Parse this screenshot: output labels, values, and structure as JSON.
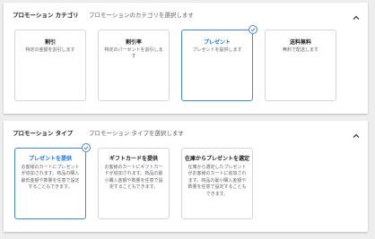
{
  "category_panel": {
    "title": "プロモーション カテゴリ",
    "subtitle": "プロモーションのカテゴリを選択します",
    "cards": [
      {
        "title": "割引",
        "desc": "特定の金額を割引します"
      },
      {
        "title": "割引率",
        "desc": "特定のパーセントを割引します"
      },
      {
        "title": "プレゼント",
        "desc": "プレゼントを提供します"
      },
      {
        "title": "送料無料",
        "desc": "無料で配送します"
      }
    ],
    "selected_index": 2
  },
  "type_panel": {
    "title": "プロモーション タイプ",
    "subtitle": "プロモーション タイプを選択します",
    "cards": [
      {
        "title": "プレゼントを提供",
        "desc": "お客様のカートにプレゼントが追加されます。商品の購入最低金額や数量を任意で設定することもできます。"
      },
      {
        "title": "ギフトカードを提供",
        "desc": "お客様のカートにギフトカードが追加されます。商品の最小購入金額や数量を任意で設定することもできます。"
      },
      {
        "title": "在庫からプレゼントを選定",
        "desc": "在庫から選定したプレゼントがお客様のカートに追加されます。商品の最小購入金額や数量を任意で設定することもできます。"
      }
    ],
    "selected_index": 0
  },
  "colors": {
    "accent": "#1a73e8",
    "selected_border": "#4a86cf",
    "background": "#eeeeee",
    "panel": "#ffffff"
  },
  "icons": {
    "collapse": "chevron-up-icon",
    "selected": "check-circle-icon"
  }
}
